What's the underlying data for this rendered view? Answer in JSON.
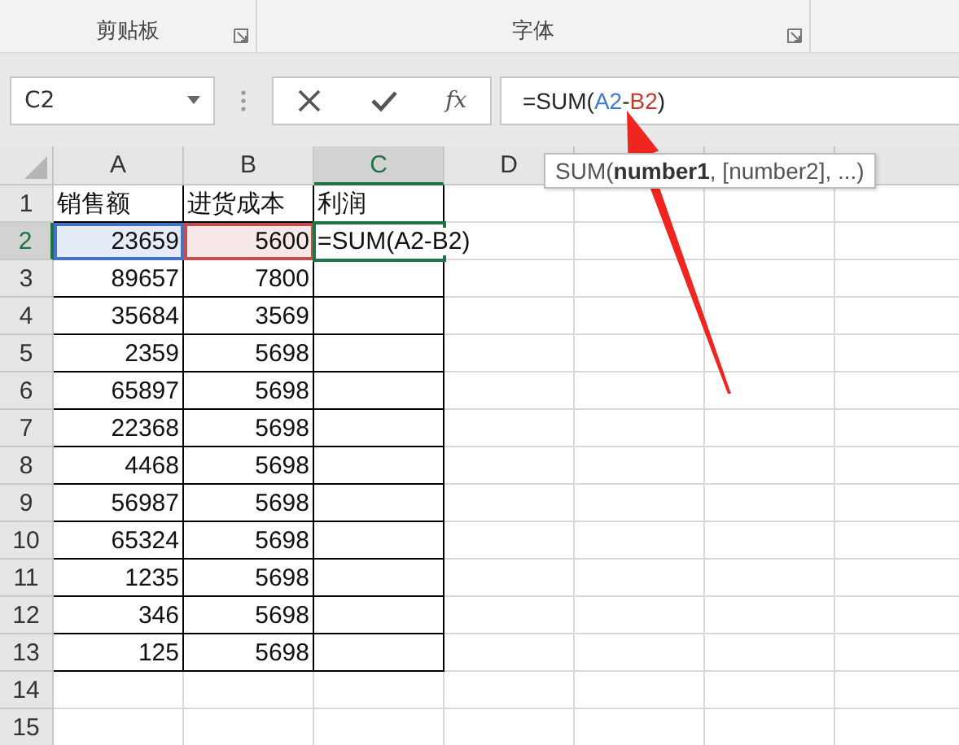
{
  "ribbon": {
    "groups": [
      {
        "label": "剪贴板"
      },
      {
        "label": "字体"
      }
    ]
  },
  "formula_bar": {
    "name_box": "C2",
    "buttons": [
      {
        "kind": "cancel"
      },
      {
        "kind": "enter"
      },
      {
        "kind": "function",
        "label": "fx"
      }
    ],
    "formula": [
      {
        "text": "=SUM(",
        "color": "#262626"
      },
      {
        "text": "A2",
        "color": "#3c78d8"
      },
      {
        "text": "-",
        "color": "#262626"
      },
      {
        "text": "B2",
        "color": "#c0392b"
      },
      {
        "text": ")",
        "color": "#262626"
      }
    ]
  },
  "tooltip": "SUM(**number1**, [number2], ...)",
  "columns": [
    {
      "label": "A",
      "selected": false
    },
    {
      "label": "B",
      "selected": false
    },
    {
      "label": "C",
      "selected": true
    },
    {
      "label": "D",
      "selected": false
    }
  ],
  "rows": [
    {
      "label": "1",
      "selected": false,
      "bordered": true,
      "cells": [
        {
          "text": "销售额",
          "kind": "text"
        },
        {
          "text": "进货成本",
          "kind": "text"
        },
        {
          "text": "利润",
          "kind": "text"
        }
      ]
    },
    {
      "label": "2",
      "selected": true,
      "bordered": true,
      "cells": [
        {
          "text": "23659",
          "kind": "number",
          "color": "#4472c4"
        },
        {
          "text": "5600",
          "kind": "number",
          "color": "#c0504d"
        },
        {
          "text": "=SUM(A2-B2)",
          "kind": "text",
          "active": true
        }
      ]
    },
    {
      "label": "3",
      "selected": false,
      "bordered": true,
      "cells": [
        {
          "text": "89657",
          "kind": "number"
        },
        {
          "text": "7800",
          "kind": "number"
        }
      ]
    },
    {
      "label": "4",
      "selected": false,
      "bordered": true,
      "cells": [
        {
          "text": "35684",
          "kind": "number"
        },
        {
          "text": "3569",
          "kind": "number"
        }
      ]
    },
    {
      "label": "5",
      "selected": false,
      "bordered": true,
      "cells": [
        {
          "text": "2359",
          "kind": "number"
        },
        {
          "text": "5698",
          "kind": "number"
        }
      ]
    },
    {
      "label": "6",
      "selected": false,
      "bordered": true,
      "cells": [
        {
          "text": "65897",
          "kind": "number"
        },
        {
          "text": "5698",
          "kind": "number"
        }
      ]
    },
    {
      "label": "7",
      "selected": false,
      "bordered": true,
      "cells": [
        {
          "text": "22368",
          "kind": "number"
        },
        {
          "text": "5698",
          "kind": "number"
        }
      ]
    },
    {
      "label": "8",
      "selected": false,
      "bordered": true,
      "cells": [
        {
          "text": "4468",
          "kind": "number"
        },
        {
          "text": "5698",
          "kind": "number"
        }
      ]
    },
    {
      "label": "9",
      "selected": false,
      "bordered": true,
      "cells": [
        {
          "text": "56987",
          "kind": "number"
        },
        {
          "text": "5698",
          "kind": "number"
        }
      ]
    },
    {
      "label": "10",
      "selected": false,
      "bordered": true,
      "cells": [
        {
          "text": "65324",
          "kind": "number"
        },
        {
          "text": "5698",
          "kind": "number"
        }
      ]
    },
    {
      "label": "11",
      "selected": false,
      "bordered": true,
      "cells": [
        {
          "text": "1235",
          "kind": "number"
        },
        {
          "text": "5698",
          "kind": "number"
        }
      ]
    },
    {
      "label": "12",
      "selected": false,
      "bordered": true,
      "cells": [
        {
          "text": "346",
          "kind": "number"
        },
        {
          "text": "5698",
          "kind": "number"
        }
      ]
    },
    {
      "label": "13",
      "selected": false,
      "bordered": true,
      "cells": [
        {
          "text": "125",
          "kind": "number"
        },
        {
          "text": "5698",
          "kind": "number"
        }
      ]
    },
    {
      "label": "14",
      "selected": false,
      "bordered": false,
      "cells": []
    },
    {
      "label": "15",
      "selected": false,
      "bordered": false,
      "cells": []
    }
  ]
}
